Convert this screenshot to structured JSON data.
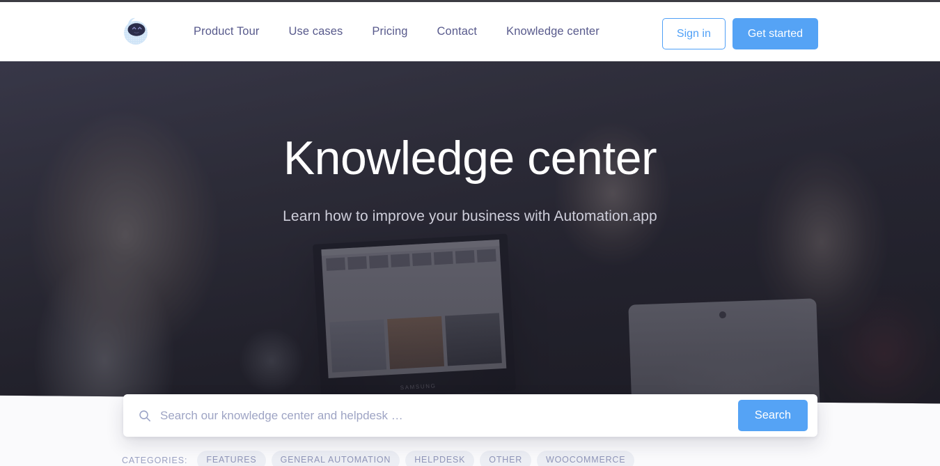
{
  "header": {
    "logo": {
      "icon": "automation-mascot-logo",
      "body_color": "#cfe4f7",
      "face_color": "#2b2d4a"
    },
    "nav": [
      {
        "label": "Product Tour"
      },
      {
        "label": "Use cases"
      },
      {
        "label": "Pricing"
      },
      {
        "label": "Contact"
      },
      {
        "label": "Knowledge center"
      }
    ],
    "sign_in_label": "Sign in",
    "get_started_label": "Get started",
    "nav_color": "#585a8c",
    "accent_color": "#55a3f5"
  },
  "hero": {
    "title": "Knowledge center",
    "subtitle": "Learn how to improve your business with Automation.app",
    "laptop_brand": "SAMSUNG",
    "overlay_color": "#2d2c3e"
  },
  "search": {
    "icon": "search-icon",
    "placeholder": "Search our knowledge center and helpdesk …",
    "value": "",
    "button_label": "Search"
  },
  "categories": {
    "label": "CATEGORIES:",
    "items": [
      {
        "label": "FEATURES"
      },
      {
        "label": "GENERAL AUTOMATION"
      },
      {
        "label": "HELPDESK"
      },
      {
        "label": "OTHER"
      },
      {
        "label": "WOOCOMMERCE"
      }
    ]
  }
}
